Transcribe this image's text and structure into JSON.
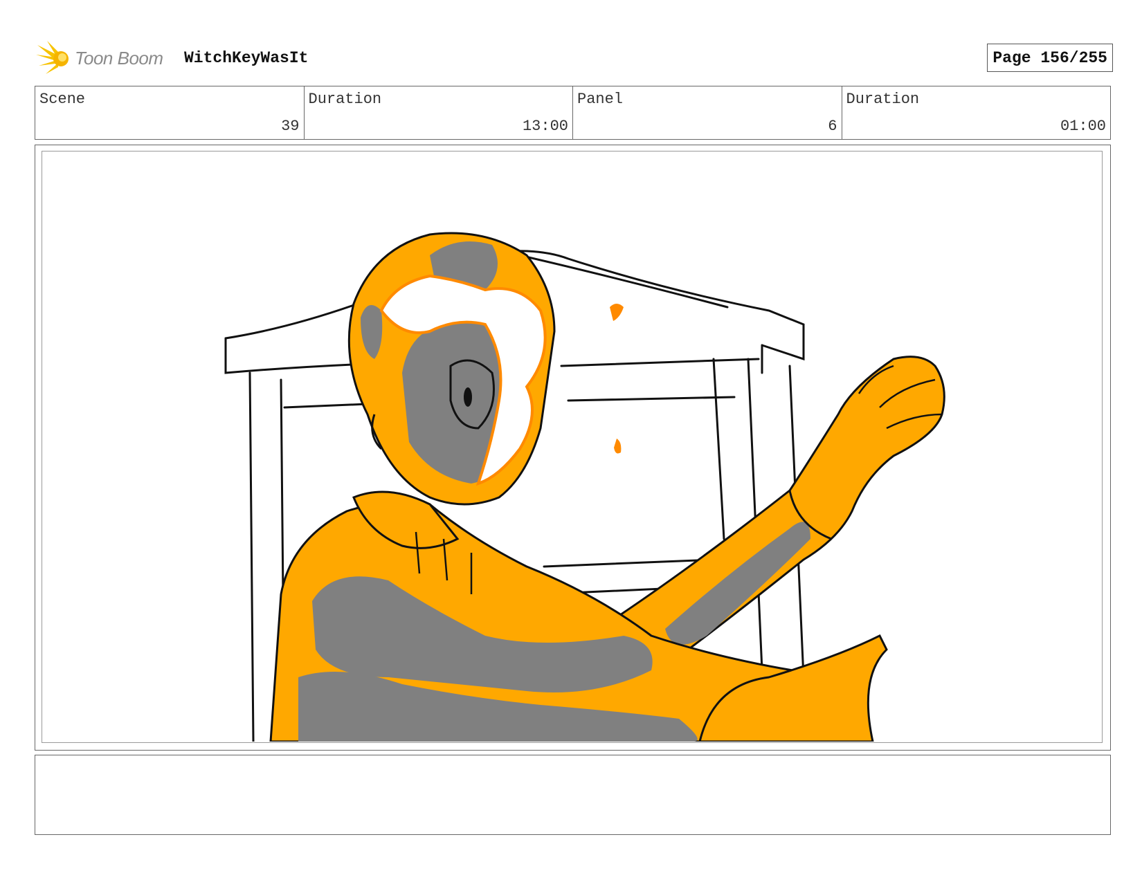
{
  "header": {
    "logo_text": "Toon Boom",
    "project_title": "WitchKeyWasIt",
    "page_label": "Page 156/255"
  },
  "info": {
    "scene_label": "Scene",
    "scene_value": "39",
    "scene_duration_label": "Duration",
    "scene_duration_value": "13:00",
    "panel_label": "Panel",
    "panel_value": "6",
    "panel_duration_label": "Duration",
    "panel_duration_value": "01:00"
  },
  "panel": {
    "description": ""
  },
  "notes": {
    "text": ""
  },
  "colors": {
    "figure_fill": "#FFA800",
    "shadow": "#808080",
    "hair_outline": "#FF8A00",
    "line": "#111111"
  }
}
